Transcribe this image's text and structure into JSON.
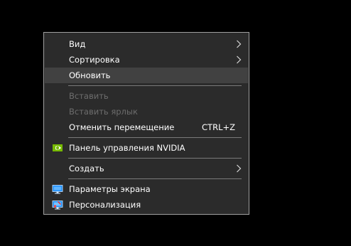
{
  "menu": {
    "items": {
      "view": {
        "label": "Вид"
      },
      "sort": {
        "label": "Сортировка"
      },
      "refresh": {
        "label": "Обновить"
      },
      "paste": {
        "label": "Вставить"
      },
      "paste_shortcut": {
        "label": "Вставить ярлык"
      },
      "undo_move": {
        "label": "Отменить перемещение",
        "shortcut": "CTRL+Z"
      },
      "nvidia": {
        "label": "Панель управления NVIDIA"
      },
      "create": {
        "label": "Создать"
      },
      "display": {
        "label": "Параметры экрана"
      },
      "personalize": {
        "label": "Персонализация"
      }
    }
  },
  "colors": {
    "menu_background": "#2b2b2b",
    "hover_background": "#414141",
    "border": "#a0a0a0",
    "text": "#ffffff",
    "disabled_text": "#6d6d6d",
    "nvidia_green": "#76b900",
    "display_icon_blue": "#1e90ff"
  },
  "icons": {
    "submenu": "chevron-right-icon",
    "nvidia": "nvidia-logo-icon",
    "display": "display-settings-icon",
    "personalize": "personalize-icon"
  }
}
